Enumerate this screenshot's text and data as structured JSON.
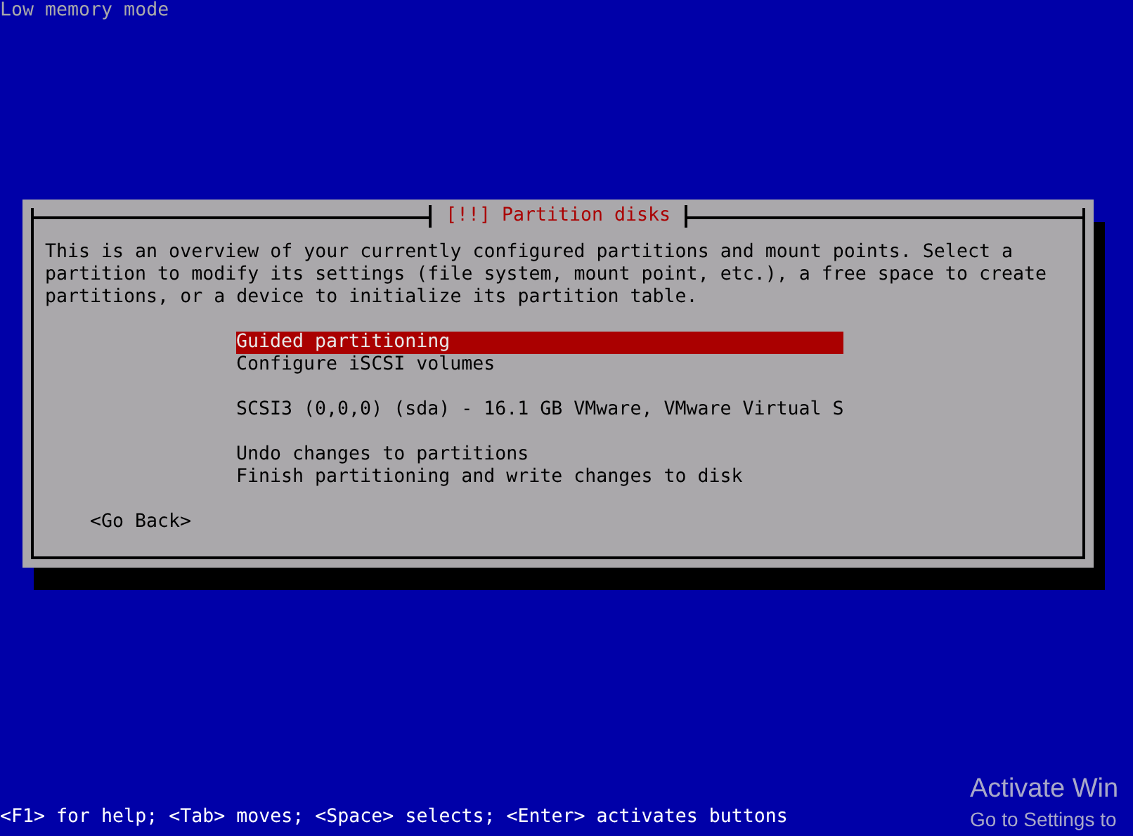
{
  "top_line": "Low memory mode",
  "dialog": {
    "title": "[!!] Partition disks",
    "description": "This is an overview of your currently configured partitions and mount points. Select a\npartition to modify its settings (file system, mount point, etc.), a free space to create\npartitions, or a device to initialize its partition table.",
    "item_groups": [
      {
        "items": [
          {
            "label": "Guided partitioning",
            "selected": true
          },
          {
            "label": "Configure iSCSI volumes",
            "selected": false
          }
        ]
      },
      {
        "items": [
          {
            "label": "SCSI3 (0,0,0) (sda) - 16.1 GB VMware, VMware Virtual S",
            "selected": false
          }
        ]
      },
      {
        "items": [
          {
            "label": "Undo changes to partitions",
            "selected": false
          },
          {
            "label": "Finish partitioning and write changes to disk",
            "selected": false
          }
        ]
      }
    ],
    "back_button": "<Go Back>"
  },
  "status_line": "<F1> for help; <Tab> moves; <Space> selects; <Enter> activates buttons",
  "activation_notice": {
    "title": "Activate Win",
    "subtitle": "Go to Settings to"
  }
}
